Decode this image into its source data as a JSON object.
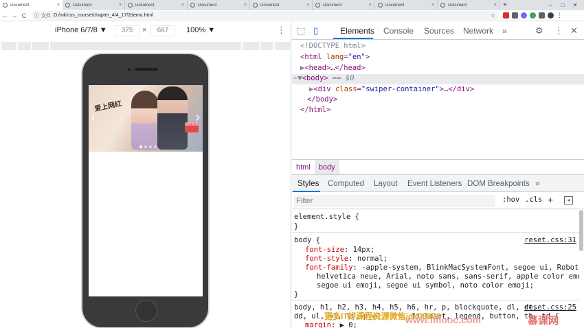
{
  "browser": {
    "tabs": [
      {
        "title": "Document",
        "close": "×"
      },
      {
        "title": "Document",
        "close": "×"
      },
      {
        "title": "Document",
        "close": "×"
      },
      {
        "title": "Document",
        "close": "×"
      },
      {
        "title": "Document",
        "close": "×"
      },
      {
        "title": "Document",
        "close": "×"
      },
      {
        "title": "Document",
        "close": "×"
      },
      {
        "title": "Document",
        "close": "×"
      }
    ],
    "new_tab": "+",
    "window_controls": {
      "minimize": "–",
      "maximize": "□",
      "close": "✕"
    },
    "nav": {
      "back": "←",
      "forward": "→",
      "reload": "C"
    },
    "address": {
      "scheme_label": "文件",
      "url": "D:/mk/css_course/chapter_4/4_17/2demo.html"
    }
  },
  "device_toolbar": {
    "device": "iPhone 6/7/8 ▼",
    "width": "375",
    "times": "×",
    "height": "667",
    "zoom": "100% ▼",
    "more": "⋮"
  },
  "banner": {
    "title": "爱上网红",
    "badge": "限时特惠",
    "prev_arrow": "‹",
    "next_arrow": "›"
  },
  "devtools": {
    "main_tabs": [
      "Elements",
      "Console",
      "Sources",
      "Network",
      "»"
    ],
    "dom": {
      "doctype": "<!DOCTYPE html>",
      "html_open": "html",
      "html_attr": "lang",
      "html_val": "\"en\"",
      "head": "<head>…</head>",
      "body_open": "<body>",
      "body_suffix": "== $0",
      "div_tag": "div",
      "div_attr": "class",
      "div_val": "\"swiper-container\"",
      "div_tail": ">…</div>",
      "body_close": "</body>",
      "html_close": "</html>"
    },
    "breadcrumbs": [
      "html",
      "body"
    ],
    "sub_tabs": [
      "Styles",
      "Computed",
      "Layout",
      "Event Listeners",
      "DOM Breakpoints",
      "»"
    ],
    "filter": {
      "placeholder": "Filter",
      "hov": ":hov",
      "cls": ".cls",
      "plus": "+"
    },
    "styles": {
      "element_style": "element.style {",
      "close_brace": "}",
      "body_rule": "body {",
      "body_source": "reset.css:31",
      "font_size_prop": "font-size",
      "font_size_val": "14px;",
      "font_style_prop": "font-style",
      "font_style_val": "normal;",
      "font_family_prop": "font-family",
      "font_family_val_1": "-apple-system, BlinkMacSystemFont, segoe ui, Roboto,",
      "font_family_val_2": "helvetica neue, Arial, noto sans, sans-serif, apple color emoji,",
      "font_family_val_3": "segoe ui emoji, segoe ui symbol, noto color emoji;",
      "reset_rule_1": "body, h1, h2, h3, h4, h5, h6, hr, p, blockquote, dl, dt,",
      "reset_source": "reset.css:25",
      "reset_rule_2": "dd, ul, ol, li, pre, form, fieldset, legend, button, th, td {",
      "margin_prop": "margin",
      "margin_val": "▶ 0;"
    }
  },
  "watermark": {
    "line1": "更多IT好课程资源微信jdx08878",
    "site": "www.imooc.com",
    "brand": "慕课网"
  },
  "colors": {
    "accent": "#1a73e8",
    "tag": "#881280",
    "attr": "#994500",
    "property": "#c80000"
  }
}
